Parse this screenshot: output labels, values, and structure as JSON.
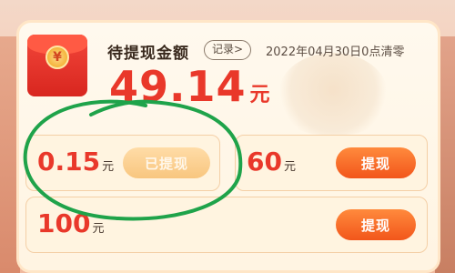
{
  "header": {
    "title": "待提现金额",
    "record_label": "记录",
    "record_chevron": ">",
    "reset_note": "2022年04月30日0点清零"
  },
  "balance": {
    "amount": "49.14",
    "unit": "元",
    "envelope_symbol": "¥"
  },
  "options": [
    {
      "value": "0.15",
      "unit": "元",
      "button_label": "已提现",
      "state": "withdrawn"
    },
    {
      "value": "60",
      "unit": "元",
      "button_label": "提现",
      "state": "available"
    },
    {
      "value": "100",
      "unit": "元",
      "button_label": "提现",
      "state": "available"
    }
  ],
  "colors": {
    "accent_red": "#e9382a",
    "button_orange": "#f2561b",
    "annotation_green": "#1fa34a"
  },
  "icons": {
    "envelope": "red-envelope-icon",
    "chevron": "chevron-right-icon"
  }
}
